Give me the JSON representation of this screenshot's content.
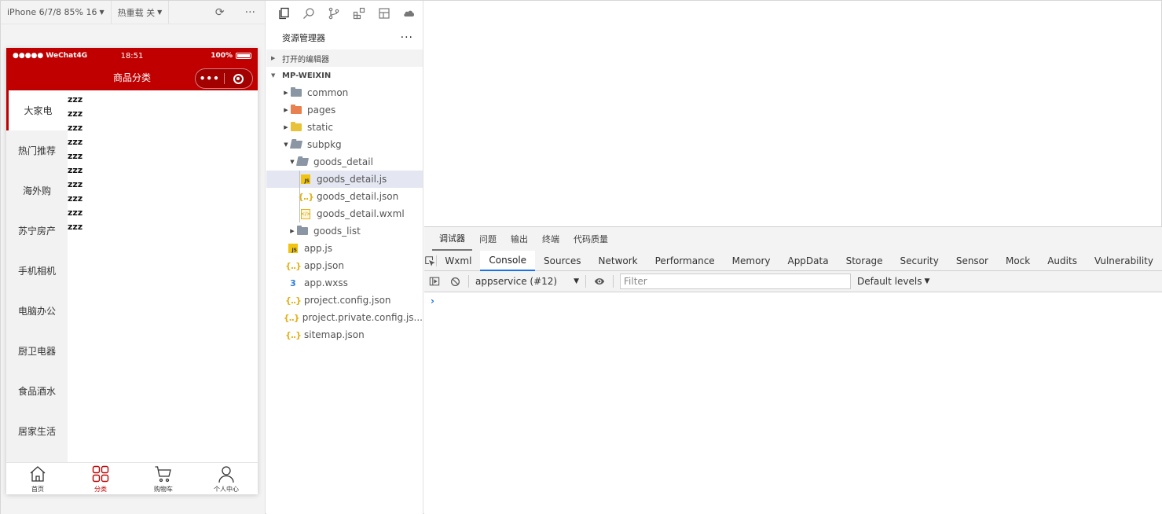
{
  "simulator": {
    "device_label": "iPhone 6/7/8 85% 16",
    "hot_reload_label": "热重载 关",
    "phone": {
      "status": {
        "carrier": "●●●●● WeChat4G",
        "time": "18:51",
        "battery": "100%"
      },
      "nav_title": "商品分类",
      "capsule_dots": "•••",
      "menu": [
        "大家电",
        "热门推荐",
        "海外购",
        "苏宁房产",
        "手机相机",
        "电脑办公",
        "厨卫电器",
        "食品酒水",
        "居家生活"
      ],
      "active_menu_index": 0,
      "list_rows": [
        "zzz",
        "zzz",
        "zzz",
        "zzz",
        "zzz",
        "zzz",
        "zzz",
        "zzz",
        "zzz",
        "zzz"
      ],
      "tabbar": [
        {
          "label": "首页",
          "icon": "home-icon",
          "active": false
        },
        {
          "label": "分类",
          "icon": "category-grid-icon",
          "active": true
        },
        {
          "label": "购物车",
          "icon": "cart-icon",
          "active": false
        },
        {
          "label": "个人中心",
          "icon": "user-icon",
          "active": false
        }
      ]
    },
    "colors": {
      "accent": "#c00000"
    }
  },
  "explorer": {
    "title": "资源管理器",
    "more": "···",
    "open_editors": "打开的编辑器",
    "project": "MP-WEIXIN",
    "tree": [
      {
        "name": "common",
        "type": "folder",
        "depth": 0,
        "arrow": "▸"
      },
      {
        "name": "pages",
        "type": "folder-orange",
        "depth": 0,
        "arrow": "▸"
      },
      {
        "name": "static",
        "type": "folder-yellow",
        "depth": 0,
        "arrow": "▸"
      },
      {
        "name": "subpkg",
        "type": "folder-open",
        "depth": 0,
        "arrow": "▾"
      },
      {
        "name": "goods_detail",
        "type": "folder-open",
        "depth": 1,
        "arrow": "▾"
      },
      {
        "name": "goods_detail.js",
        "type": "js",
        "depth": 2,
        "arrow": "",
        "selected": true
      },
      {
        "name": "goods_detail.json",
        "type": "json",
        "depth": 2,
        "arrow": ""
      },
      {
        "name": "goods_detail.wxml",
        "type": "wxml",
        "depth": 2,
        "arrow": ""
      },
      {
        "name": "goods_list",
        "type": "folder",
        "depth": 1,
        "arrow": "▸"
      },
      {
        "name": "app.js",
        "type": "js",
        "depth": 0,
        "arrow": ""
      },
      {
        "name": "app.json",
        "type": "json",
        "depth": 0,
        "arrow": ""
      },
      {
        "name": "app.wxss",
        "type": "css",
        "depth": 0,
        "arrow": ""
      },
      {
        "name": "project.config.json",
        "type": "json",
        "depth": 0,
        "arrow": ""
      },
      {
        "name": "project.private.config.js...",
        "type": "json",
        "depth": 0,
        "arrow": ""
      },
      {
        "name": "sitemap.json",
        "type": "json",
        "depth": 0,
        "arrow": ""
      }
    ]
  },
  "debugger": {
    "top_tabs": [
      "调试器",
      "问题",
      "输出",
      "终端",
      "代码质量"
    ],
    "active_top_tab": 0,
    "tabs": [
      "Wxml",
      "Console",
      "Sources",
      "Network",
      "Performance",
      "Memory",
      "AppData",
      "Storage",
      "Security",
      "Sensor",
      "Mock",
      "Audits",
      "Vulnerability"
    ],
    "active_tab": 1,
    "context": "appservice (#12)",
    "filter_placeholder": "Filter",
    "levels": "Default levels",
    "prompt": "›"
  }
}
